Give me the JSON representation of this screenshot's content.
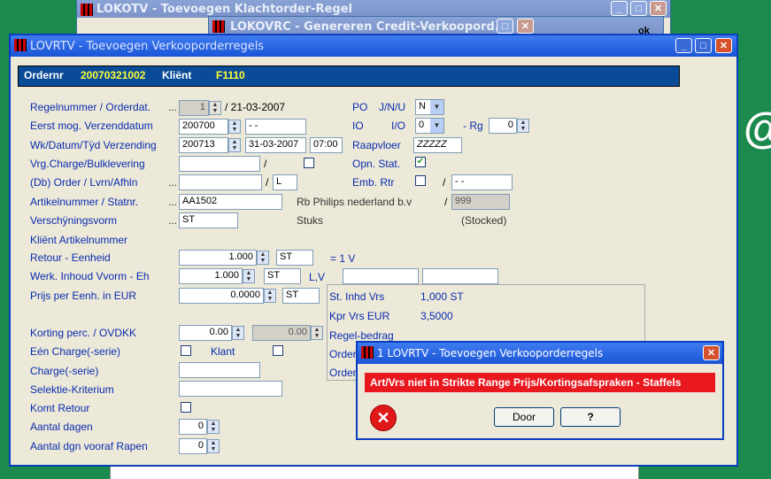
{
  "bg_window1": {
    "title": "LOKOTV - Toevoegen Klachtorder-Regel"
  },
  "bg_window2": {
    "title": "LOKOVRC - Genereren Credit-Verkoopord..."
  },
  "bg_window2_ok": "ok",
  "main_window": {
    "title": "LOVRTV - Toevoegen Verkooporderregels",
    "header": {
      "ordernr_label": "Ordernr",
      "ordernr_value": "20070321002",
      "klient_label": "Kliënt",
      "klient_value": "F1110"
    },
    "labels": {
      "regelnummer": "Regelnummer / Orderdat.",
      "eerst_mog": "Eerst mog. Verzenddatum",
      "wk_datum": "Wk/Datum/Tÿd Verzending",
      "vrg_charge": "Vrg.Charge/Bulklevering",
      "db_order": "(Db) Order / Lvrn/Afhln",
      "artikelnummer": "Artikelnummer / Statnr.",
      "verschijningsvorm": "Verschÿningsvorm",
      "klient_artikelnummer": "Kliënt Artikelnummer",
      "retour_eenheid": "Retour - Eenheid",
      "werk_inhoud": "Werk. Inhoud Vvorm - Eh",
      "prijs_per_eenh": "Prijs per Eenh. in EUR",
      "korting": "Korting perc. / OVDKK",
      "een_charge": "Eén Charge(-serie)",
      "charge_serie": "Charge(-serie)",
      "selektie": "Selektie-Kriterium",
      "komt_retour": "Komt Retour",
      "aantal_dagen": "Aantal dagen",
      "aantal_dgn_rapen": "Aantal dgn vooraf Rapen",
      "po": "PO",
      "jnu": "J/N/U",
      "io": "IO",
      "io2": "I/O",
      "rg": "- Rg",
      "raapvloer": "Raapvloer",
      "opn_stat": "Opn. Stat.",
      "emb_rtr": "Emb. Rtr",
      "rb_philips": "Rb Philips nederland b.v",
      "stuks": "Stuks",
      "stocked": "(Stocked)",
      "eq1v": "= 1 V",
      "lv": "L,V",
      "klant": "Klant",
      "slash": "/"
    },
    "ellipsis": "...",
    "values": {
      "regelnummer": "1",
      "orderdat": "/ 21-03-2007",
      "eerst_mog": "200700",
      "eerst_mog_date": " -  -",
      "wk": "200713",
      "datum": "31-03-2007",
      "tijd": "07:00",
      "db_order_2": "L",
      "artikelnummer": "AA1502",
      "verschijningsvorm": "ST",
      "retour": "1.000",
      "retour_eh": "ST",
      "werk_inhoud": "1.000",
      "werk_eh": "ST",
      "prijs": "0.0000",
      "prijs_eh": "ST",
      "korting": "0.00",
      "ovdkk": "0.00",
      "aantal_dagen": "0",
      "aantal_dgn_rapen": "0",
      "po_select": "N",
      "io_select": "0",
      "rg": "0",
      "raapvloer": "ZZZZZ",
      "emb_rtr_date": " -  -",
      "statnr": "999"
    },
    "info_panel": {
      "st_inhd_label": "St. Inhd Vrs",
      "st_inhd_value": "1,000 ST",
      "kpr_vrs_label": "Kpr Vrs  EUR",
      "kpr_vrs_value": "3,5000",
      "regelbedrag": "Regel-bedrag",
      "order1": "Order",
      "order2": "Order"
    }
  },
  "dialog": {
    "title": "1 LOVRTV - Toevoegen Verkooporderregels",
    "message": "Art/Vrs niet in Strikte Range Prijs/Kortingsafspraken - Staffels",
    "door_button": "Door",
    "help_button": "?"
  },
  "colors": {
    "header_bar": "#0a4b98",
    "header_values": "#ffff33",
    "error_red": "#e8181e",
    "accent_green": "#1c8a4c"
  }
}
